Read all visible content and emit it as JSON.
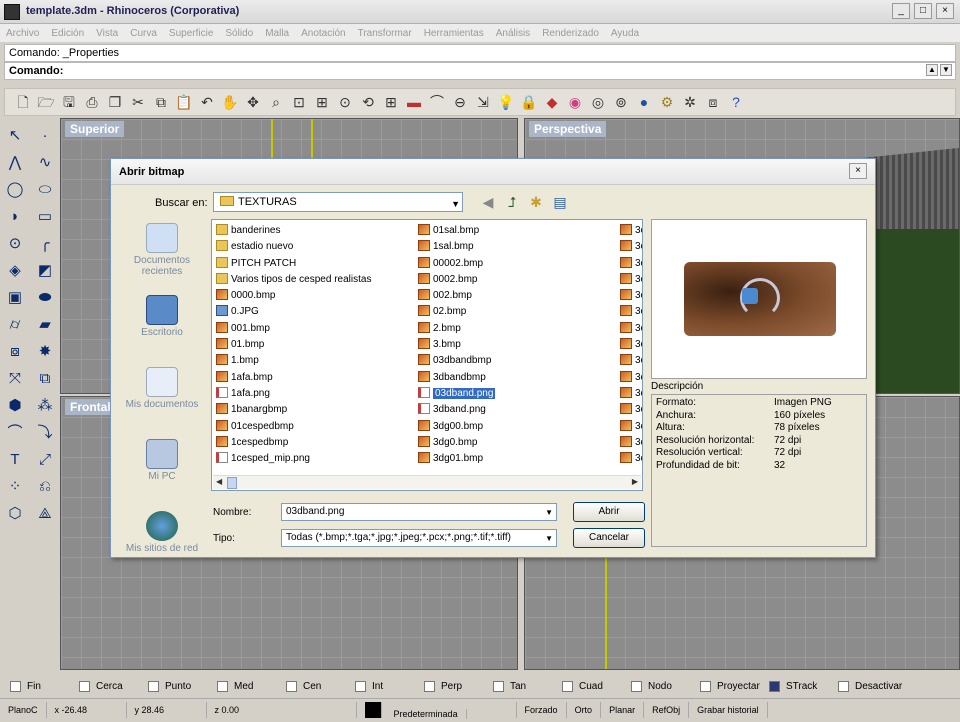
{
  "window": {
    "title": "template.3dm - Rhinoceros (Corporativa)",
    "btns": [
      "_",
      "□",
      "×"
    ]
  },
  "menu": [
    "Archivo",
    "Edición",
    "Vista",
    "Curva",
    "Superficie",
    "Sólido",
    "Malla",
    "Anotación",
    "Transformar",
    "Herramientas",
    "Análisis",
    "Renderizado",
    "Ayuda"
  ],
  "command": {
    "history": "Comando: _Properties",
    "prompt": "Comando:"
  },
  "viewports": {
    "top": "Superior",
    "perspective": "Perspectiva",
    "front": "Frontal"
  },
  "dialog": {
    "title": "Abrir bitmap",
    "look_in_label": "Buscar en:",
    "look_in_value": "TEXTURAS",
    "places": [
      "Documentos recientes",
      "Escritorio",
      "Mis documentos",
      "Mi PC",
      "Mis sitios de red"
    ],
    "files_col1": [
      {
        "name": "banderines",
        "type": "folder"
      },
      {
        "name": "estadio nuevo",
        "type": "folder"
      },
      {
        "name": "PITCH PATCH",
        "type": "folder"
      },
      {
        "name": "Varios tipos de cesped realistas",
        "type": "folder"
      },
      {
        "name": "0000.bmp",
        "type": "bmp"
      },
      {
        "name": "0.JPG",
        "type": "jpg"
      },
      {
        "name": "001.bmp",
        "type": "bmp"
      },
      {
        "name": "01.bmp",
        "type": "bmp"
      },
      {
        "name": "1.bmp",
        "type": "bmp"
      },
      {
        "name": "1afa.bmp",
        "type": "bmp"
      },
      {
        "name": "1afa.png",
        "type": "png"
      },
      {
        "name": "1banargbmp",
        "type": "bmp"
      },
      {
        "name": "01cespedbmp",
        "type": "bmp"
      },
      {
        "name": "1cespedbmp",
        "type": "bmp"
      },
      {
        "name": "1cesped_mip.png",
        "type": "png"
      }
    ],
    "files_col2": [
      {
        "name": "01sal.bmp",
        "type": "bmp"
      },
      {
        "name": "1sal.bmp",
        "type": "bmp"
      },
      {
        "name": "00002.bmp",
        "type": "bmp"
      },
      {
        "name": "0002.bmp",
        "type": "bmp"
      },
      {
        "name": "002.bmp",
        "type": "bmp"
      },
      {
        "name": "02.bmp",
        "type": "bmp"
      },
      {
        "name": "2.bmp",
        "type": "bmp"
      },
      {
        "name": "3.bmp",
        "type": "bmp"
      },
      {
        "name": "03dbandbmp",
        "type": "bmp"
      },
      {
        "name": "3dbandbmp",
        "type": "bmp"
      },
      {
        "name": "03dband.png",
        "type": "png",
        "selected": true
      },
      {
        "name": "3dband.png",
        "type": "png"
      },
      {
        "name": "3dg00.bmp",
        "type": "bmp"
      },
      {
        "name": "3dg0.bmp",
        "type": "bmp"
      },
      {
        "name": "3dg01.bmp",
        "type": "bmp"
      }
    ],
    "files_col3": [
      "3c",
      "3c",
      "3c",
      "3c",
      "3c",
      "3c",
      "3c",
      "3c",
      "3c",
      "3c",
      "3c",
      "3c",
      "3c",
      "3c",
      "3c"
    ],
    "desc_label": "Descripción",
    "description": [
      {
        "k": "Formato:",
        "v": "Imagen PNG"
      },
      {
        "k": "Anchura:",
        "v": "160 píxeles"
      },
      {
        "k": "Altura:",
        "v": "78 píxeles"
      },
      {
        "k": "Resolución horizontal:",
        "v": "72 dpi"
      },
      {
        "k": "Resolución vertical:",
        "v": "72 dpi"
      },
      {
        "k": "Profundidad de bit:",
        "v": "32"
      }
    ],
    "filename_label": "Nombre:",
    "filename_value": "03dband.png",
    "type_label": "Tipo:",
    "type_value": "Todas (*.bmp;*.tga;*.jpg;*.jpeg;*.pcx;*.png;*.tif;*.tiff)",
    "open_button": "Abrir",
    "cancel_button": "Cancelar"
  },
  "osnaps": [
    {
      "label": "Fin",
      "on": false
    },
    {
      "label": "Cerca",
      "on": false
    },
    {
      "label": "Punto",
      "on": false
    },
    {
      "label": "Med",
      "on": false
    },
    {
      "label": "Cen",
      "on": false
    },
    {
      "label": "Int",
      "on": false
    },
    {
      "label": "Perp",
      "on": false
    },
    {
      "label": "Tan",
      "on": false
    },
    {
      "label": "Cuad",
      "on": false
    },
    {
      "label": "Nodo",
      "on": false
    },
    {
      "label": "Proyectar",
      "on": false
    },
    {
      "label": "STrack",
      "on": true
    },
    {
      "label": "Desactivar",
      "on": false
    }
  ],
  "status": {
    "plane": "PlanoC",
    "x": "x -26.48",
    "y": "y 28.46",
    "z": "z 0.00",
    "layer": "Predeterminada",
    "forced": "Forzado",
    "ortho": "Orto",
    "planar": "Planar",
    "refobj": "RefObj",
    "history": "Grabar historial"
  }
}
